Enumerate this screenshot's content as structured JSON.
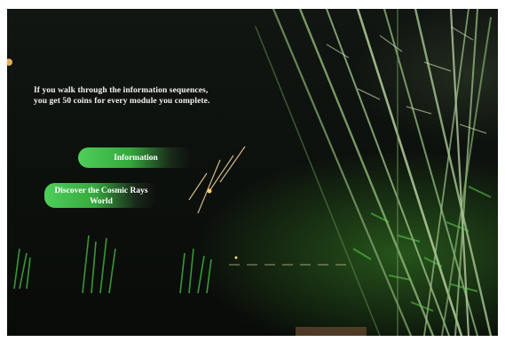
{
  "screen": {
    "message": "If you walk through the information sequences, you get 50 coins for every module you complete.",
    "buttons": {
      "information_label": "Information",
      "discover_label": "Discover the Cosmic Rays World"
    }
  },
  "colors": {
    "button_gradient_start": "#4fcf5a",
    "button_gradient_end": "#0d0d0d",
    "text": "#f2f2f2"
  }
}
